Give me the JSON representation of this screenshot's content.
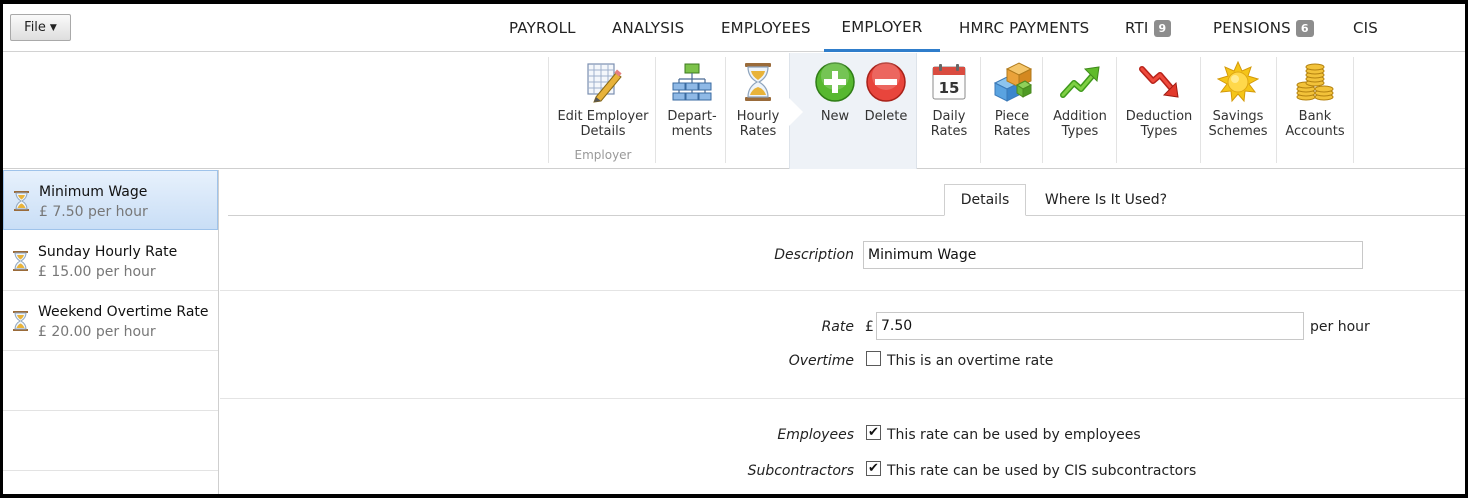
{
  "file_menu": {
    "label": "File"
  },
  "nav": {
    "tabs": [
      {
        "label": "PAYROLL"
      },
      {
        "label": "ANALYSIS"
      },
      {
        "label": "EMPLOYEES"
      },
      {
        "label": "EMPLOYER",
        "active": true
      },
      {
        "label": "HMRC PAYMENTS"
      },
      {
        "label": "RTI",
        "badge": "9"
      },
      {
        "label": "PENSIONS",
        "badge": "6"
      },
      {
        "label": "CIS"
      }
    ]
  },
  "ribbon": {
    "group_label": "Employer",
    "buttons": {
      "edit_employer": "Edit Employer\nDetails",
      "departments": "Depart-\nments",
      "hourly_rates": "Hourly\nRates",
      "new": "New",
      "delete": "Delete",
      "daily_rates": "Daily\nRates",
      "piece_rates": "Piece\nRates",
      "addition_types": "Addition\nTypes",
      "deduction_types": "Deduction\nTypes",
      "savings_schemes": "Savings\nSchemes",
      "bank_accounts": "Bank\nAccounts"
    },
    "calendar_day": "15"
  },
  "rates_list": [
    {
      "name": "Minimum Wage",
      "rate": "£ 7.50 per hour",
      "selected": true
    },
    {
      "name": "Sunday Hourly Rate",
      "rate": "£ 15.00 per hour"
    },
    {
      "name": "Weekend Overtime Rate",
      "rate": "£ 20.00 per hour"
    }
  ],
  "detail": {
    "tabs": {
      "details": "Details",
      "where_used": "Where Is It Used?"
    },
    "description": {
      "label": "Description",
      "value": "Minimum Wage"
    },
    "rate": {
      "label": "Rate",
      "currency": "£",
      "value": "7.50",
      "unit": "per hour"
    },
    "overtime": {
      "label": "Overtime",
      "text": "This is an overtime rate",
      "checked": false
    },
    "employees": {
      "label": "Employees",
      "text": "This rate can be used by employees",
      "checked": true
    },
    "subcontractors": {
      "label": "Subcontractors",
      "text": "This rate can be used by CIS subcontractors",
      "checked": true
    }
  },
  "colors": {
    "accent": "#2f7dcb",
    "selection": "#c9def6",
    "badge": "#8d8d8d"
  }
}
